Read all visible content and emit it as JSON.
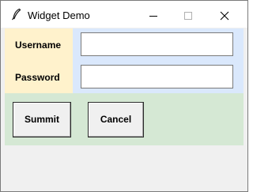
{
  "window": {
    "title": "Widget Demo",
    "icon": "feather-icon"
  },
  "form": {
    "username_label": "Username",
    "username_value": "",
    "password_label": "Password",
    "password_value": ""
  },
  "buttons": {
    "submit_label": "Summit",
    "cancel_label": "Cancel"
  },
  "colors": {
    "label_bg": "#fff2cc",
    "entry_bg": "#dae8fc",
    "button_row_bg": "#d5e8d4",
    "window_bg": "#f0f0f0"
  }
}
